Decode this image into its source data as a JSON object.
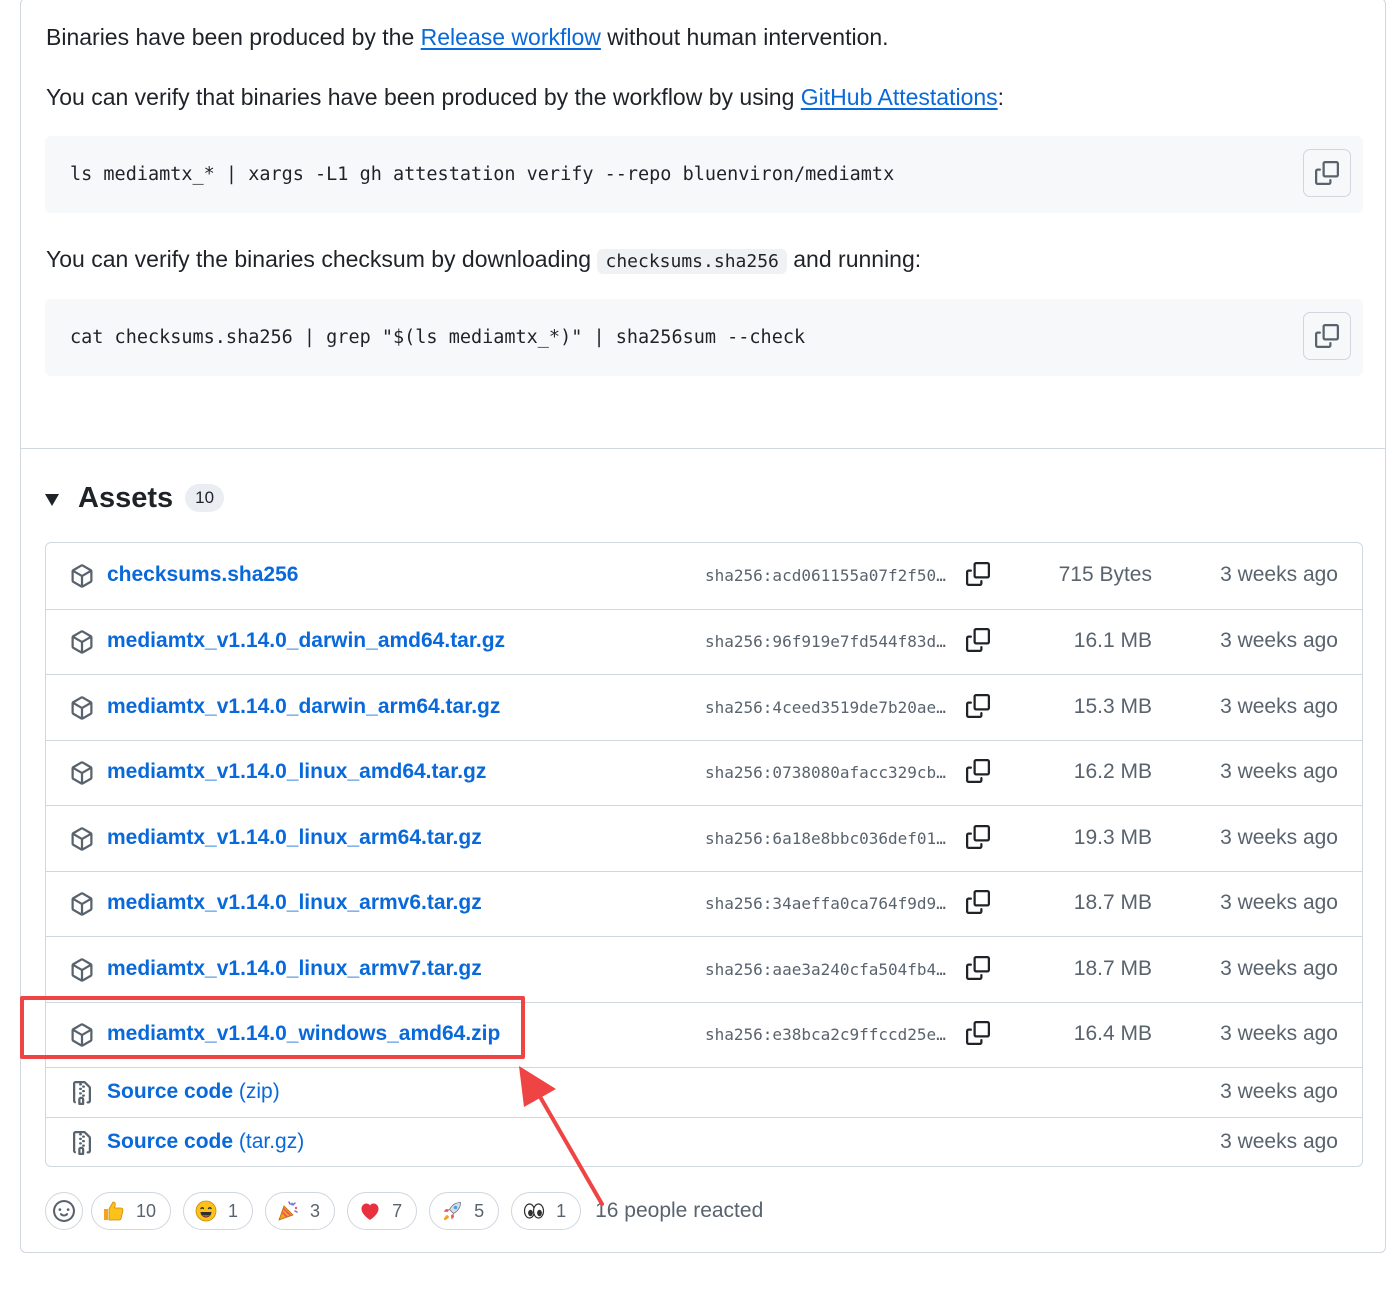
{
  "intro": {
    "line1_pre": "Binaries have been produced by the ",
    "line1_link": "Release workflow",
    "line1_post": " without human intervention.",
    "line2_pre": "You can verify that binaries have been produced by the workflow by using ",
    "line2_link": "GitHub Attestations",
    "line2_post": ":",
    "code1": "ls mediamtx_* | xargs -L1 gh attestation verify --repo bluenviron/mediamtx",
    "line3_pre": "You can verify the binaries checksum by downloading ",
    "line3_code": "checksums.sha256",
    "line3_post": " and running:",
    "code2": "cat checksums.sha256 | grep \"$(ls mediamtx_*)\" | sha256sum --check"
  },
  "assets": {
    "title": "Assets",
    "count": "10",
    "files": [
      {
        "name": "checksums.sha256",
        "hash": "sha256:acd061155a07f2f50…",
        "size": "715 Bytes",
        "date": "3 weeks ago"
      },
      {
        "name": "mediamtx_v1.14.0_darwin_amd64.tar.gz",
        "hash": "sha256:96f919e7fd544f83d…",
        "size": "16.1 MB",
        "date": "3 weeks ago"
      },
      {
        "name": "mediamtx_v1.14.0_darwin_arm64.tar.gz",
        "hash": "sha256:4ceed3519de7b20ae…",
        "size": "15.3 MB",
        "date": "3 weeks ago"
      },
      {
        "name": "mediamtx_v1.14.0_linux_amd64.tar.gz",
        "hash": "sha256:0738080afacc329cb…",
        "size": "16.2 MB",
        "date": "3 weeks ago"
      },
      {
        "name": "mediamtx_v1.14.0_linux_arm64.tar.gz",
        "hash": "sha256:6a18e8bbc036def01…",
        "size": "19.3 MB",
        "date": "3 weeks ago"
      },
      {
        "name": "mediamtx_v1.14.0_linux_armv6.tar.gz",
        "hash": "sha256:34aeffa0ca764f9d9…",
        "size": "18.7 MB",
        "date": "3 weeks ago"
      },
      {
        "name": "mediamtx_v1.14.0_linux_armv7.tar.gz",
        "hash": "sha256:aae3a240cfa504fb4…",
        "size": "18.7 MB",
        "date": "3 weeks ago"
      },
      {
        "name": "mediamtx_v1.14.0_windows_amd64.zip",
        "hash": "sha256:e38bca2c9ffccd25e…",
        "size": "16.4 MB",
        "date": "3 weeks ago"
      }
    ],
    "sources": [
      {
        "label": "Source code",
        "fmt": " (zip)",
        "date": "3 weeks ago"
      },
      {
        "label": "Source code",
        "fmt": " (tar.gz)",
        "date": "3 weeks ago"
      }
    ]
  },
  "reactions": {
    "items": [
      {
        "emoji": "thumbs-up-icon",
        "count": "10"
      },
      {
        "emoji": "laugh-icon",
        "count": "1"
      },
      {
        "emoji": "hooray-icon",
        "count": "3"
      },
      {
        "emoji": "heart-icon",
        "count": "7"
      },
      {
        "emoji": "rocket-icon",
        "count": "5"
      },
      {
        "emoji": "eyes-icon",
        "count": "1"
      }
    ],
    "summary": "16 people reacted"
  },
  "colors": {
    "link": "#0969da",
    "annotation": "#ef4444",
    "muted": "#59636e",
    "border": "#d0d7de"
  }
}
